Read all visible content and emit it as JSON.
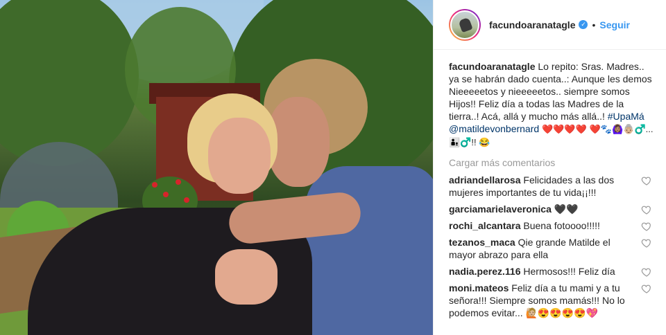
{
  "post": {
    "username": "facundoaranatagle",
    "verified_icon": "verified-check-icon",
    "follow_label": "Seguir",
    "caption_user": "facundoaranatagle",
    "caption_text": "Lo repito: Sras. Madres.. ya se habrán dado cuenta..: Aunque les demos Nieeeeetos y nieeeeetos.. siempre somos Hijos!! Feliz día a todas las Madres de la tierra..! Acá, allá y mucho más allá..!",
    "hashtag": "#UpaMá",
    "mention": "@matildevonbernard",
    "emoji_line_1": "❤️❤️❤️❤️",
    "emoji_line_2": "❤️🐾🙆🏽‍♀️👵🏼♂️... 👨‍👦♂️!! 😂",
    "load_more_label": "Cargar más comentarios"
  },
  "comments": [
    {
      "user": "adriandellarosa",
      "text": "Felicidades a las dos mujeres importantes de tu vida¡¡!!!"
    },
    {
      "user": "garciamarielaveronica",
      "text": "🖤🖤"
    },
    {
      "user": "rochi_alcantara",
      "text": "Buena fotoooo!!!!!"
    },
    {
      "user": "tezanos_maca",
      "text": "Qie grande Matilde el mayor abrazo para ella"
    },
    {
      "user": "nadia.perez.116",
      "text": "Hermosos!!! Feliz día"
    },
    {
      "user": "moni.mateos",
      "text": "Feliz día a tu mami y a tu señora!!! Siempre somos mamás!!! No lo podemos evitar... 🙋🏼😍😍😍😍💖"
    }
  ],
  "colors": {
    "link": "#3897f0",
    "mention": "#003569",
    "muted": "#999999"
  }
}
